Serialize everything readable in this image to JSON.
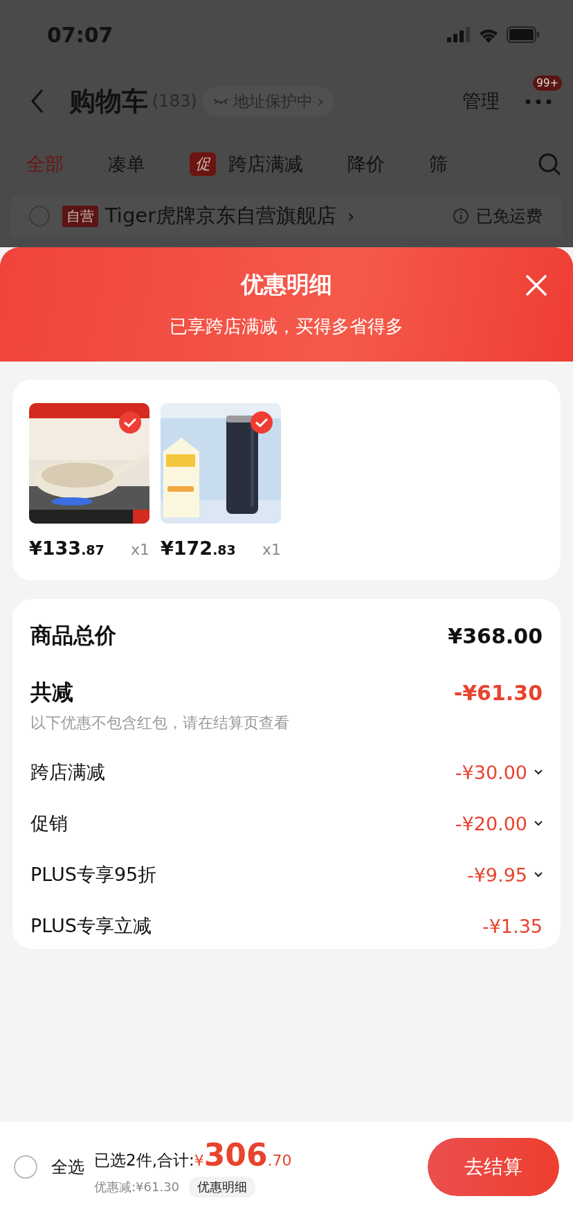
{
  "status_bar": {
    "time": "07:07"
  },
  "header": {
    "title": "购物车",
    "count": "(183)",
    "address_badge": "地址保护中",
    "address_chevron": "›",
    "manage": "管理",
    "notification_badge": "99+"
  },
  "tabs": [
    {
      "label": "全部",
      "selected": true
    },
    {
      "label": "凑单",
      "selected": false
    },
    {
      "label": "跨店满减",
      "selected": false,
      "tag": "促"
    },
    {
      "label": "降价",
      "selected": false
    },
    {
      "label": "筛",
      "selected": false
    }
  ],
  "store": {
    "checked": false,
    "chevron": "›",
    "tag": "自营",
    "name": "Tiger虎牌京东自营旗舰店",
    "shipping": "已免运费"
  },
  "sheet": {
    "title": "优惠明细",
    "subtitle": "已享跨店满减，买得多省得多",
    "products": [
      {
        "kind": "picture",
        "checked": true,
        "price_int": "¥133",
        "price_dec": ".87",
        "qty": "x1"
      },
      {
        "kind": "picture",
        "checked": true,
        "price_int": "¥172",
        "price_dec": ".83",
        "qty": "x1"
      }
    ],
    "total": {
      "label": "商品总价",
      "value": "¥368.00"
    },
    "reduction": {
      "label": "共减",
      "value": "-¥61.30",
      "note": "以下优惠不包含红包，请在结算页查看"
    },
    "discounts": [
      {
        "label": "跨店满减",
        "value": "-¥30.00",
        "expandable": true
      },
      {
        "label": "促销",
        "value": "-¥20.00",
        "expandable": true
      },
      {
        "label": "PLUS专享95折",
        "value": "-¥9.95",
        "expandable": true
      },
      {
        "label": "PLUS专享立减",
        "value": "-¥1.35",
        "expandable": false
      }
    ]
  },
  "bottom_bar": {
    "select_all": "全选",
    "select_all_checked": false,
    "summary": "已选2件,合计:",
    "currency": "¥",
    "total_int": "306",
    "total_dec": ".70",
    "saved": "优惠减:¥61.30",
    "details_button": "优惠明细",
    "checkout": "去结算"
  }
}
